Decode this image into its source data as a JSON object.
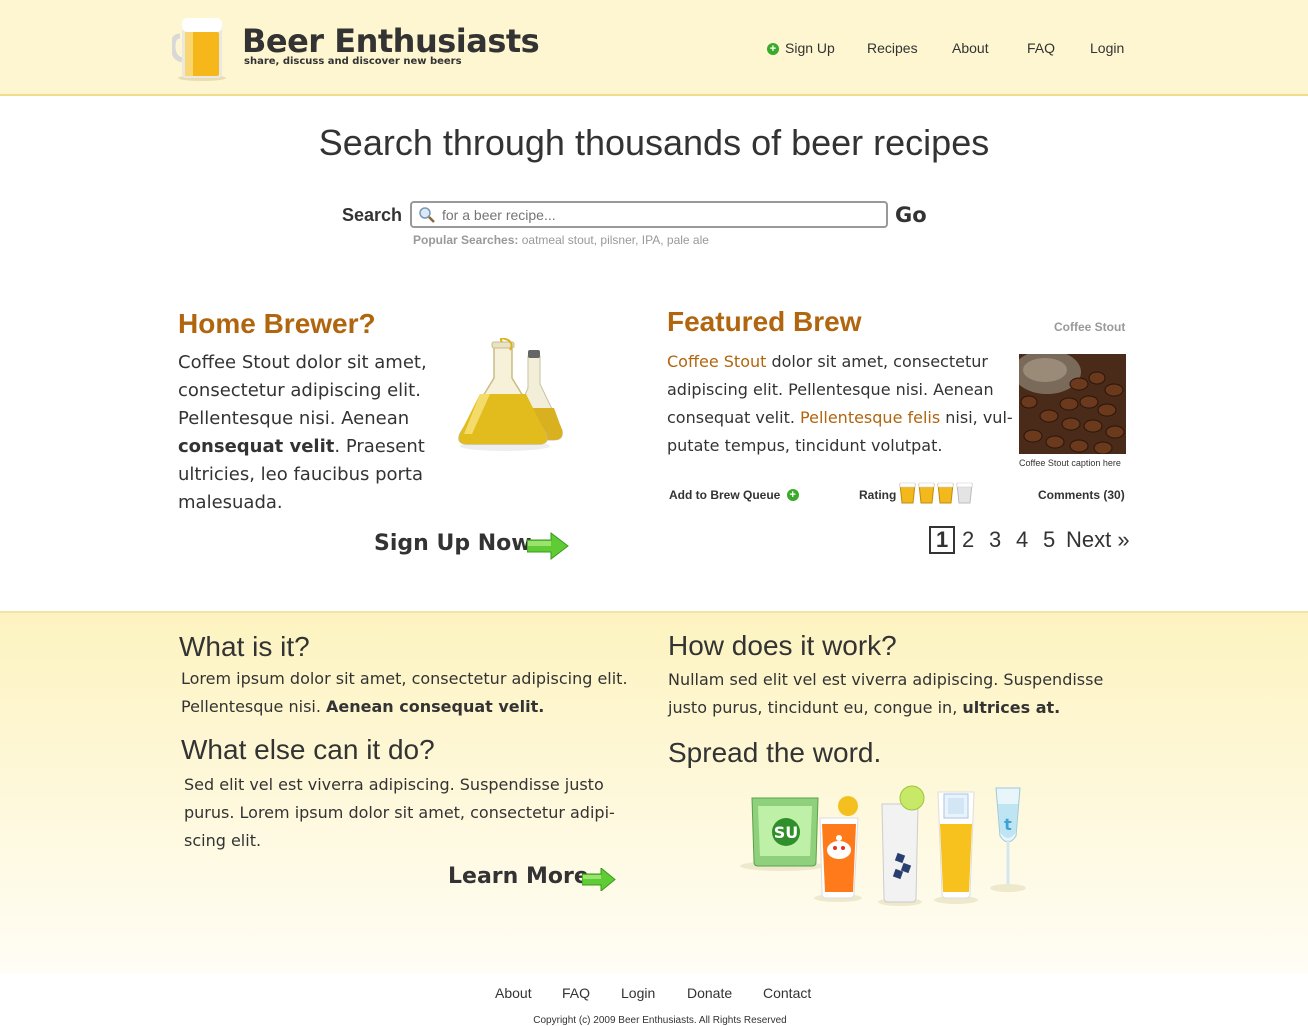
{
  "header": {
    "title": "Beer Enthusiasts",
    "tagline": "share, discuss and discover new beers",
    "nav": [
      "Sign Up",
      "Recipes",
      "About",
      "FAQ",
      "Login"
    ]
  },
  "hero": {
    "title": "Search through thousands of beer recipes",
    "search_label": "Search",
    "search_placeholder": "for a beer recipe...",
    "go_label": "Go",
    "popular_label": "Popular Searches:",
    "popular_terms": "oatmeal stout, pilsner, IPA, pale ale"
  },
  "home_brewer": {
    "heading": "Home Brewer?",
    "line1": "Coffee Stout dolor sit amet,",
    "line2": "consectetur adipiscing elit.",
    "line3": "Pellentesque nisi. Aenean",
    "bold": "consequat velit",
    "line4_rest": ". Praesent",
    "line5": "ultricies, leo faucibus porta",
    "line6": "malesuada.",
    "cta": "Sign Up Now"
  },
  "featured": {
    "heading": "Featured Brew",
    "image_title": "Coffee Stout",
    "link1": "Coffee Stout",
    "line1_rest": " dolor sit amet, consectetur",
    "line2": "adipiscing elit. Pellentesque nisi. Aenean",
    "line3_pre": "consequat velit. ",
    "link2": "Pellentesque felis",
    "line3_post": " nisi, vul-",
    "line4": "putate tempus, tincidunt volutpat.",
    "caption": "Coffee Stout caption here",
    "add_queue": "Add to Brew Queue",
    "rating_label": "Rating",
    "rating": 3,
    "rating_max": 4,
    "comments": "Comments (30)",
    "pages": [
      "1",
      "2",
      "3",
      "4",
      "5"
    ],
    "next": "Next »"
  },
  "info": {
    "what_heading": "What is it?",
    "what_line1": "Lorem ipsum dolor sit amet, consectetur adipiscing elit.",
    "what_line2_pre": "Pellentesque nisi. ",
    "what_line2_bold": "Aenean consequat velit.",
    "else_heading": "What else can it do?",
    "else_line1": "Sed elit vel est viverra adipiscing. Suspendisse justo",
    "else_line2": "purus. Lorem ipsum dolor sit amet, consectetur adipi-",
    "else_line3": "scing elit.",
    "learn_more": "Learn More",
    "how_heading": "How does it work?",
    "how_line1": "Nullam sed elit vel est viverra adipiscing. Suspendisse",
    "how_line2_pre": "justo purus, tincidunt eu, congue in, ",
    "how_line2_bold": "ultrices at.",
    "spread_heading": "Spread the word."
  },
  "footer": {
    "links": [
      "About",
      "FAQ",
      "Login",
      "Donate",
      "Contact"
    ],
    "copyright": "Copyright (c) 2009 Beer Enthusiasts. All Rights Reserved"
  },
  "colors": {
    "accent_orange": "#b0650e",
    "header_bg": "#fdf6d0",
    "green": "#3aaa2a"
  }
}
